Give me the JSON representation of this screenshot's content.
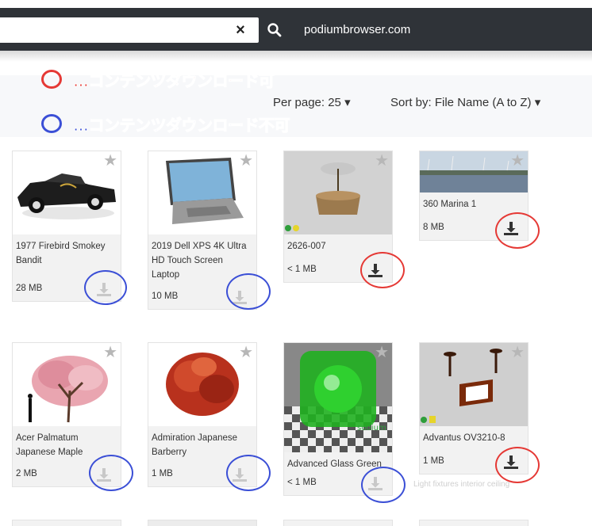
{
  "browser": {
    "site_url": "podiumbrowser.com",
    "clear_label": "×"
  },
  "toolbar": {
    "per_page_label": "Per page: 25 ▾",
    "sort_label": "Sort by: File Name (A to Z) ▾"
  },
  "legend": {
    "downloadable": {
      "text": "…コンテンツダウンロード可",
      "color": "#e53935"
    },
    "not_downloadable": {
      "text": "…コンテンツダウンロード不可",
      "color": "#3b4fd6"
    }
  },
  "cards": [
    {
      "title": "1977 Firebird Smokey Bandit",
      "size": "28 MB",
      "downloadable": false
    },
    {
      "title": "2019 Dell XPS 4K Ultra HD Touch Screen Laptop",
      "size": "10 MB",
      "downloadable": false
    },
    {
      "title": "2626-007",
      "size": "< 1 MB",
      "downloadable": true
    },
    {
      "title": "360 Marina 1",
      "size": "8 MB",
      "downloadable": true
    },
    {
      "title": "Acer Palmatum Japanese Maple",
      "size": "2 MB",
      "downloadable": false
    },
    {
      "title": "Admiration Japanese Barberry",
      "size": "1 MB",
      "downloadable": false
    },
    {
      "title": "Advanced Glass Green",
      "size": "< 1 MB",
      "downloadable": false
    },
    {
      "title": "Advantus OV3210-8",
      "size": "1 MB",
      "downloadable": true
    }
  ],
  "thumbnail_text": {
    "glass_logo": "sudium"
  },
  "ghost_text": "Light fixtures interior ceiling",
  "colors": {
    "topbar": "#2f3338",
    "download_enabled": "#333333",
    "download_disabled": "#c8c8c8"
  }
}
